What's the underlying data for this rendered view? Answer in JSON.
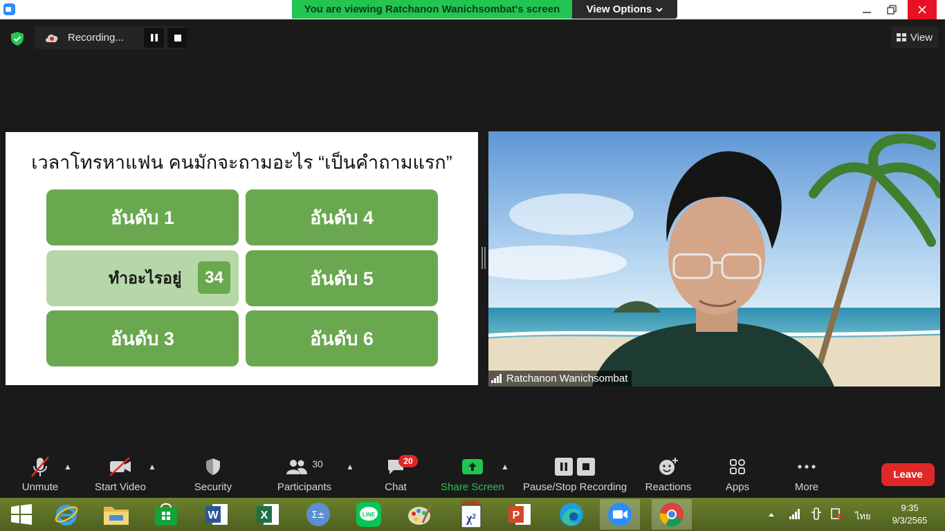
{
  "window": {
    "banner_text": "You are viewing Ratchanon Wanichsombat's screen",
    "view_options_label": "View Options",
    "minimize_icon": "minimize-icon",
    "maximize_icon": "restore-icon",
    "close_icon": "close-icon"
  },
  "top_toolbar": {
    "recording_label": "Recording...",
    "view_label": "View"
  },
  "slide": {
    "title": "เวลาโทรหาแฟน คนมักจะถามอะไร “เป็นคำถามแรก”",
    "tiles": [
      {
        "label": "อันดับ 1"
      },
      {
        "label": "อันดับ 4"
      },
      {
        "label": "ทำอะไรอยู่",
        "score": "34"
      },
      {
        "label": "อันดับ 5"
      },
      {
        "label": "อันดับ 3"
      },
      {
        "label": "อันดับ 6"
      }
    ]
  },
  "video": {
    "participant_name": "Ratchanon Wanichsombat"
  },
  "bottom_toolbar": {
    "unmute": "Unmute",
    "start_video": "Start Video",
    "security": "Security",
    "participants": "Participants",
    "participants_count": "30",
    "chat": "Chat",
    "chat_badge": "20",
    "share_screen": "Share Screen",
    "pause_stop_recording": "Pause/Stop Recording",
    "reactions": "Reactions",
    "apps": "Apps",
    "more": "More",
    "leave": "Leave"
  },
  "taskbar": {
    "apps": [
      "windows-start",
      "internet-explorer",
      "file-explorer",
      "store",
      "word",
      "excel",
      "math-input",
      "line",
      "paint",
      "lisrel",
      "powerpoint",
      "edge",
      "zoom",
      "chrome"
    ],
    "language": "ไทย",
    "time": "9:35",
    "date": "9/3/2565"
  },
  "colors": {
    "banner_green": "#23c552",
    "tile_green": "#6aa84f",
    "tile_revealed": "#b6d7a8",
    "leave_red": "#e02828",
    "share_green": "#23c552"
  }
}
